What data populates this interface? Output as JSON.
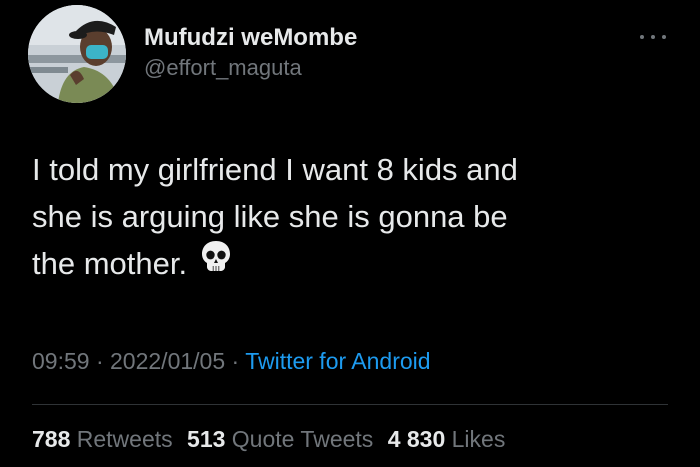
{
  "author": {
    "display_name": "Mufudzi weMombe",
    "handle": "@effort_maguta"
  },
  "tweet": {
    "lines": [
      "I told my girlfriend I want 8 kids and",
      "she is arguing like she is gonna be",
      "the mother."
    ],
    "emoji": "skull-icon"
  },
  "meta": {
    "time": "09:59",
    "sep1": "·",
    "date": "2022/01/05",
    "sep2": "·",
    "source": "Twitter for Android"
  },
  "stats": {
    "retweets_count": "788",
    "retweets_label": "Retweets",
    "quotes_count": "513",
    "quotes_label": "Quote Tweets",
    "likes_count": "4 830",
    "likes_label": "Likes"
  },
  "colors": {
    "background": "#000000",
    "text": "#e7e9ea",
    "secondary": "#71767b",
    "link": "#1d9bf0",
    "divider": "#2f3336"
  }
}
